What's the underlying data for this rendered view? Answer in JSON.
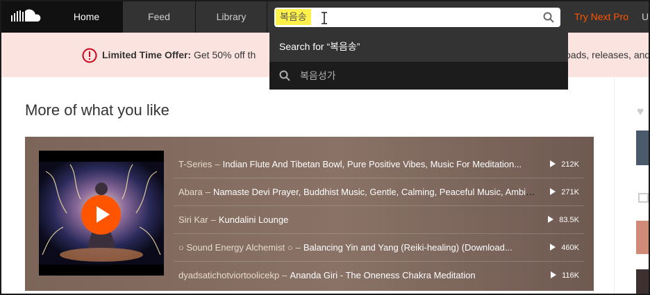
{
  "nav": {
    "home": "Home",
    "feed": "Feed",
    "library": "Library",
    "try_pro": "Try Next Pro",
    "upload_partial": "U"
  },
  "search": {
    "value": "복음송"
  },
  "dropdown": {
    "search_for": "Search for “복음송”",
    "suggestion": "복음성가"
  },
  "banner": {
    "label": "Limited Time Offer:",
    "text": "Get 50% off th",
    "right_text": "oads, releases, and"
  },
  "section": {
    "title": "More of what you like"
  },
  "tracks": [
    {
      "artist": "T-Series",
      "title": "Indian Flute And Tibetan Bowl, Pure Positive Vibes, Music For Meditation...",
      "plays": "212K"
    },
    {
      "artist": "Abara",
      "title": "Namaste Devi Prayer, Buddhist Music, Gentle, Calming, Peaceful Music, Ambien...",
      "plays": "271K"
    },
    {
      "artist": "Siri Kar",
      "title": "Kundalini Lounge",
      "plays": "83.5K"
    },
    {
      "artist": "○ Sound Energy Alchemist ○",
      "title": "Balancing Yin and Yang (Reiki-healing) (Download...",
      "plays": "460K"
    },
    {
      "artist": "dyadsatichotviortoolicekp",
      "title": "Ananda Giri - The Oneness Chakra Meditation",
      "plays": "116K"
    }
  ],
  "colors": {
    "accent": "#ff5500",
    "header_bg": "#333333",
    "banner_bg": "#fbe4e0",
    "search_highlight": "#fff14a"
  }
}
